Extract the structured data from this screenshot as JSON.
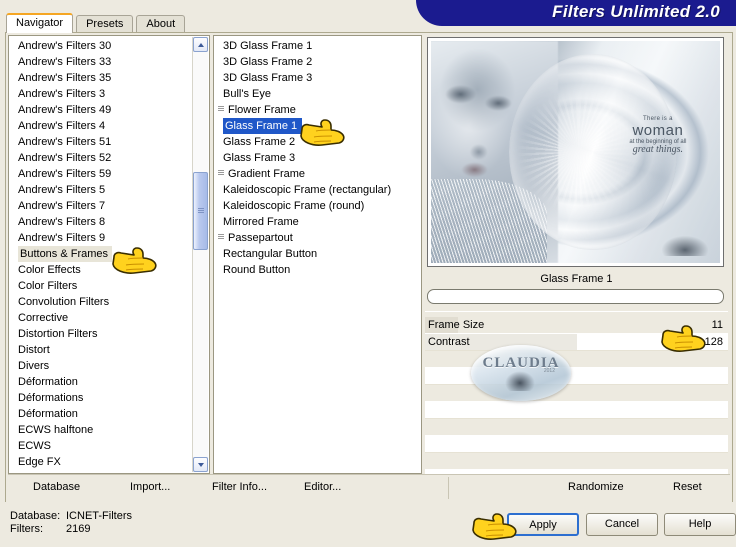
{
  "window": {
    "title": "Filters Unlimited 2.0",
    "banner_color": "#1B1B8F",
    "background_color": "#EDEAE0",
    "accent_color": "#F5A623"
  },
  "tabs": [
    {
      "label": "Navigator",
      "active": true
    },
    {
      "label": "Presets",
      "active": false
    },
    {
      "label": "About",
      "active": false
    }
  ],
  "categories": {
    "selected": "Buttons & Frames",
    "items": [
      "Andrew's Filters 30",
      "Andrew's Filters 33",
      "Andrew's Filters 35",
      "Andrew's Filters 3",
      "Andrew's Filters 49",
      "Andrew's Filters 4",
      "Andrew's Filters 51",
      "Andrew's Filters 52",
      "Andrew's Filters 59",
      "Andrew's Filters 5",
      "Andrew's Filters 7",
      "Andrew's Filters 8",
      "Andrew's Filters 9",
      "Buttons & Frames",
      "Color Effects",
      "Color Filters",
      "Convolution Filters",
      "Corrective",
      "Distortion Filters",
      "Distort",
      "Divers",
      "Déformation",
      "Déformations",
      "Déformation",
      "ECWS halftone",
      "ECWS",
      "Edge FX"
    ]
  },
  "filters": {
    "selected": "Glass Frame 1",
    "items": [
      {
        "label": "3D Glass Frame 1",
        "icon": false
      },
      {
        "label": "3D Glass Frame 2",
        "icon": false
      },
      {
        "label": "3D Glass Frame 3",
        "icon": false
      },
      {
        "label": "Bull's Eye",
        "icon": false
      },
      {
        "label": "Flower Frame",
        "icon": true
      },
      {
        "label": "Glass Frame 1",
        "icon": false
      },
      {
        "label": "Glass Frame 2",
        "icon": false
      },
      {
        "label": "Glass Frame 3",
        "icon": false
      },
      {
        "label": "Gradient Frame",
        "icon": true
      },
      {
        "label": "Kaleidoscopic Frame (rectangular)",
        "icon": false
      },
      {
        "label": "Kaleidoscopic Frame (round)",
        "icon": false
      },
      {
        "label": "Mirrored Frame",
        "icon": false
      },
      {
        "label": "Passepartout",
        "icon": true
      },
      {
        "label": "Rectangular Button",
        "icon": false
      },
      {
        "label": "Round Button",
        "icon": false
      }
    ]
  },
  "preview": {
    "alt": "silver-toned portrait of a woman with glass orb",
    "overlay_line1": "There is a",
    "overlay_line2": "woman",
    "overlay_line3": "at the beginning of all",
    "overlay_line4": "great things."
  },
  "filter_panel": {
    "name": "Glass Frame 1",
    "preset_value": "",
    "preset_placeholder": "",
    "parameters": [
      {
        "label": "Frame Size",
        "value": "11"
      },
      {
        "label": "Contrast",
        "value": "128"
      },
      {
        "label": "",
        "value": ""
      },
      {
        "label": "",
        "value": ""
      },
      {
        "label": "",
        "value": ""
      },
      {
        "label": "",
        "value": ""
      },
      {
        "label": "",
        "value": ""
      },
      {
        "label": "",
        "value": ""
      },
      {
        "label": "",
        "value": ""
      },
      {
        "label": "",
        "value": ""
      }
    ]
  },
  "watermark": {
    "text": "CLAUDIA",
    "sub": "2012"
  },
  "menu": {
    "database": "Database",
    "import": "Import...",
    "filter_info": "Filter Info...",
    "editor": "Editor...",
    "randomize": "Randomize",
    "reset": "Reset"
  },
  "status": {
    "database_label": "Database:",
    "database_value": "ICNET-Filters",
    "filters_label": "Filters:",
    "filters_value": "2169"
  },
  "buttons": {
    "apply": "Apply",
    "cancel": "Cancel",
    "help": "Help"
  },
  "scrollbar": {
    "up_icon": "chevron-up-icon",
    "down_icon": "chevron-down-icon"
  }
}
